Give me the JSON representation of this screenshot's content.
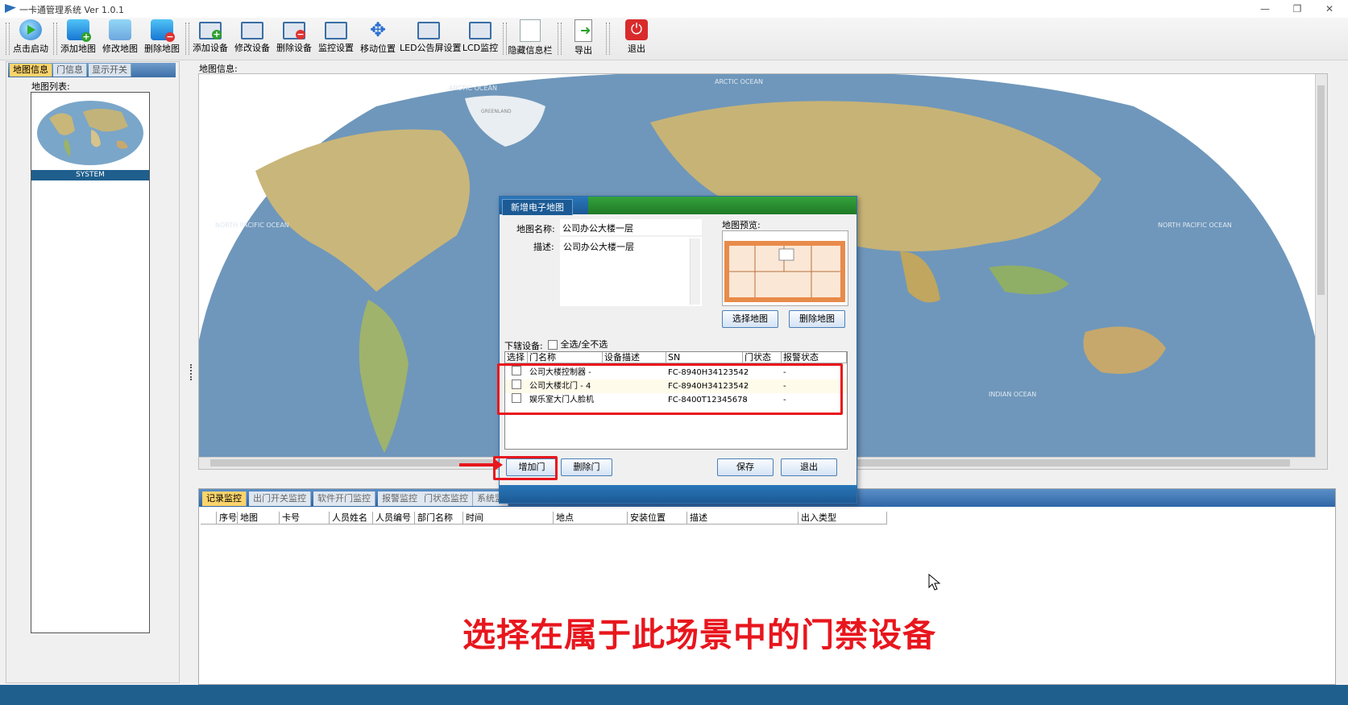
{
  "window": {
    "title": "一卡通管理系统  Ver 1.0.1",
    "btn_minimize": "—",
    "btn_restore": "❐",
    "btn_close": "✕"
  },
  "toolbar": {
    "items": [
      {
        "label": "点击启动",
        "icon": "start-icon"
      },
      {
        "label": "添加地图",
        "icon": "add-map-icon"
      },
      {
        "label": "修改地图",
        "icon": "edit-map-icon"
      },
      {
        "label": "删除地图",
        "icon": "delete-map-icon"
      },
      {
        "label": "添加设备",
        "icon": "add-device-icon"
      },
      {
        "label": "修改设备",
        "icon": "edit-device-icon"
      },
      {
        "label": "删除设备",
        "icon": "delete-device-icon"
      },
      {
        "label": "监控设置",
        "icon": "monitor-settings-icon"
      },
      {
        "label": "移动位置",
        "icon": "move-icon"
      },
      {
        "label": "LED公告屏设置",
        "icon": "led-screen-icon"
      },
      {
        "label": "LCD监控",
        "icon": "lcd-monitor-icon"
      },
      {
        "label": "隐藏信息栏",
        "icon": "hide-panel-icon"
      },
      {
        "label": "导出",
        "icon": "export-icon"
      },
      {
        "label": "退出",
        "icon": "power-icon"
      }
    ]
  },
  "left_panel": {
    "tabs": [
      "地图信息",
      "门信息",
      "显示开关"
    ],
    "active_tab": 0,
    "map_list_label": "地图列表:",
    "maps": [
      {
        "caption": "SYSTEM"
      }
    ]
  },
  "map_area": {
    "label": "地图信息:",
    "ocean_labels": [
      "ARCTIC OCEAN",
      "ARCTIC OCEAN",
      "NORTH PACIFIC OCEAN",
      "NORTH PACIFIC OCEAN",
      "INDIAN OCEAN",
      "GREENLAND"
    ]
  },
  "dialog": {
    "title": "新增电子地图",
    "map_name_label": "地图名称:",
    "map_name_value": "公司办公大楼一层",
    "desc_label": "描述:",
    "desc_value": "公司办公大楼一层",
    "preview_label": "地图预览:",
    "select_map_button": "选择地图",
    "delete_map_button": "删除地图",
    "devices_label": "下辖设备:",
    "select_all_label": "全选/全不选",
    "columns": [
      "选择",
      "门名称",
      "设备描述",
      "SN",
      "门状态",
      "报警状态"
    ],
    "rows": [
      {
        "name": "公司大楼控制器 -",
        "desc": "",
        "sn": "FC-8940H34123542",
        "door": "-",
        "alarm": "-"
      },
      {
        "name": "公司大楼北门 - 4",
        "desc": "",
        "sn": "FC-8940H34123542",
        "door": "-",
        "alarm": "-"
      },
      {
        "name": "娱乐室大门人脸机",
        "desc": "",
        "sn": "FC-8400T12345678",
        "door": "-",
        "alarm": "-"
      }
    ],
    "add_door_button": "增加门",
    "delete_door_button": "删除门",
    "save_button": "保存",
    "exit_button": "退出"
  },
  "bottom_panel": {
    "tabs": [
      "记录监控",
      "出门开关监控",
      "软件开门监控",
      "报警监控",
      "门状态监控",
      "系统监"
    ],
    "active_tab": 0,
    "columns": [
      "序号",
      "地图",
      "卡号",
      "人员姓名",
      "人员编号",
      "部门名称",
      "时间",
      "地点",
      "安装位置",
      "描述",
      "出入类型"
    ]
  },
  "subtitle": "选择在属于此场景中的门禁设备",
  "colors": {
    "accent_blue": "#1f5f8e",
    "highlight_red": "#e8161d",
    "active_tab": "#fcd46b",
    "dialog_green": "#2a8f30"
  }
}
